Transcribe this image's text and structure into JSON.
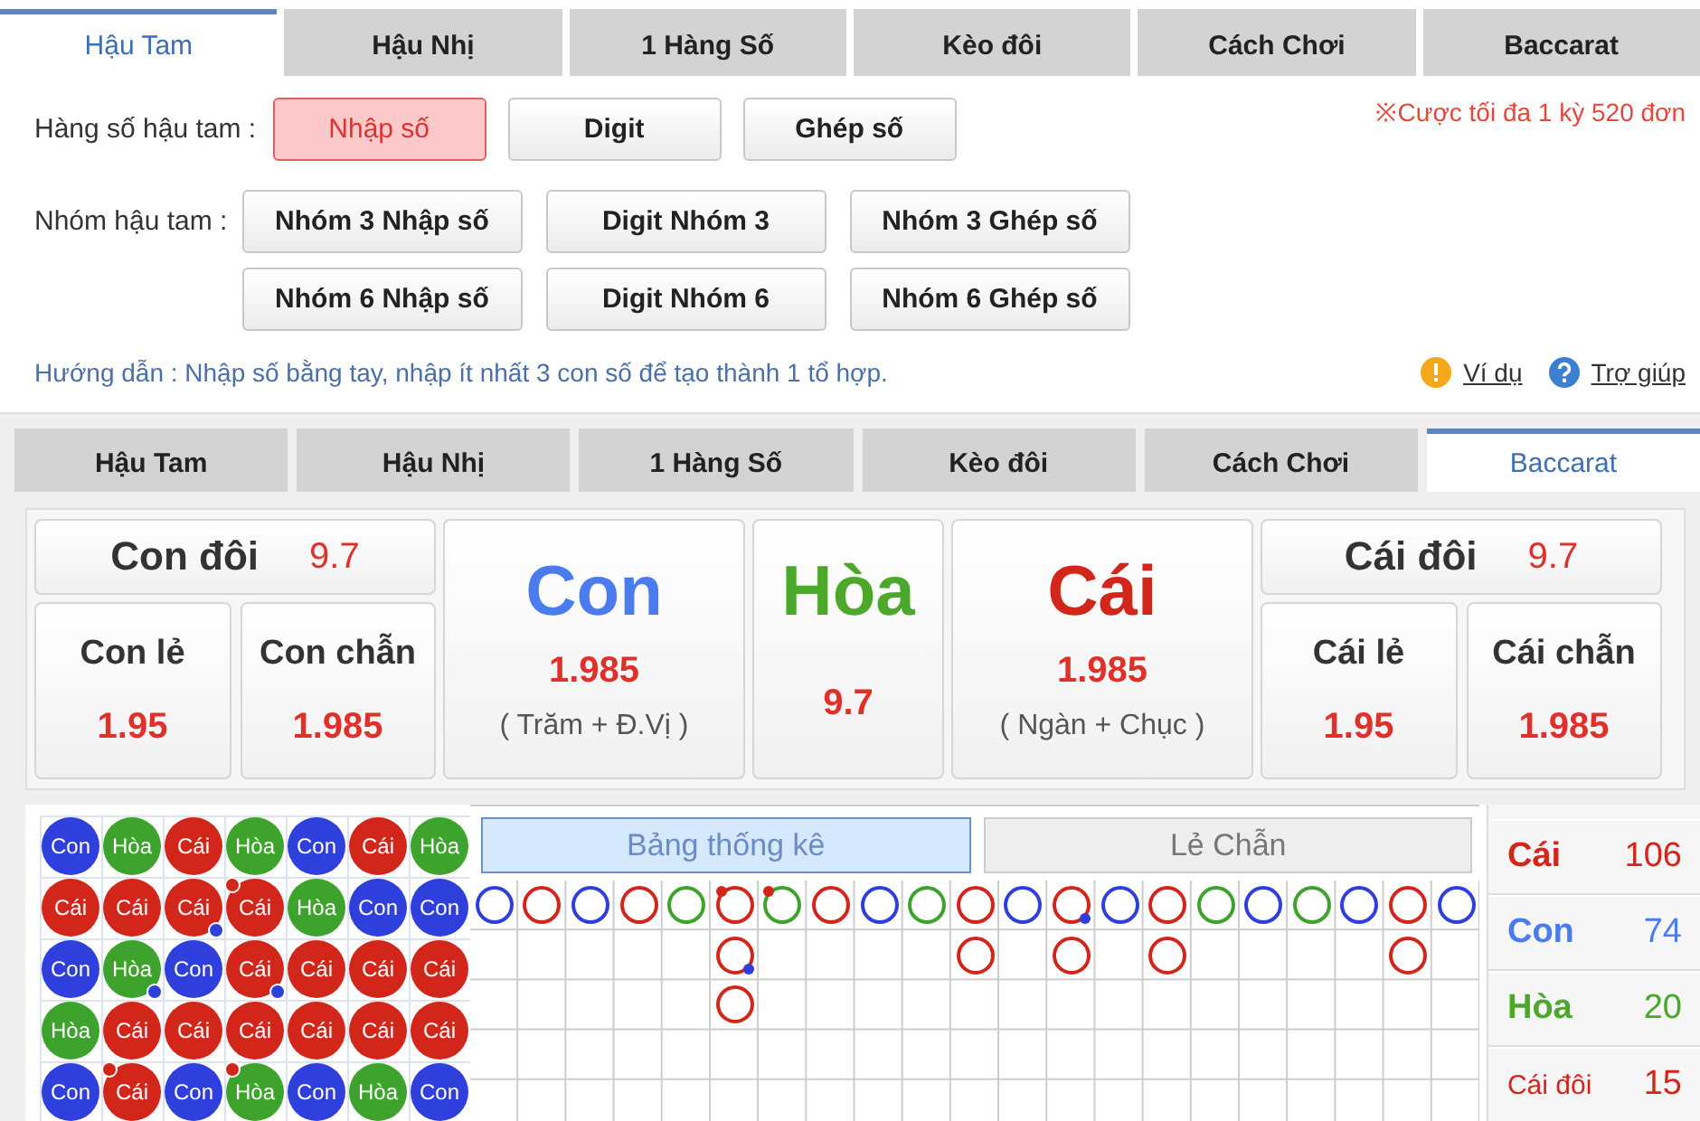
{
  "top_tabs": [
    {
      "label": "Hậu Tam",
      "selected": true
    },
    {
      "label": "Hậu Nhị",
      "selected": false
    },
    {
      "label": "1 Hàng Số",
      "selected": false
    },
    {
      "label": "Kèo đôi",
      "selected": false
    },
    {
      "label": "Cách Chơi",
      "selected": false
    },
    {
      "label": "Baccarat",
      "selected": false
    }
  ],
  "bet_groups": [
    {
      "label": "Hàng số hậu tam :",
      "options": [
        {
          "label": "Nhập số",
          "selected": true
        },
        {
          "label": "Digit",
          "selected": false
        },
        {
          "label": "Ghép số",
          "selected": false
        }
      ]
    },
    {
      "label": "Nhóm hậu tam :",
      "options": [
        {
          "label": "Nhóm 3 Nhập số",
          "selected": false
        },
        {
          "label": "Digit Nhóm 3",
          "selected": false
        },
        {
          "label": "Nhóm 3 Ghép số",
          "selected": false
        },
        {
          "label": "Nhóm 6 Nhập số",
          "selected": false
        },
        {
          "label": "Digit Nhóm 6",
          "selected": false
        },
        {
          "label": "Nhóm 6 Ghép số",
          "selected": false
        }
      ]
    }
  ],
  "limit_note": "※Cược tối đa 1 kỳ 520 đơn",
  "guide": "Hướng dẫn : Nhập số bằng tay, nhập ít nhất 3 con số để tạo thành 1 tổ hợp.",
  "links": [
    {
      "label": "Ví dụ",
      "kind": "info"
    },
    {
      "label": "Trợ giúp",
      "kind": "help"
    }
  ],
  "bottom_tabs": [
    {
      "label": "Hậu Tam",
      "selected": false
    },
    {
      "label": "Hậu Nhị",
      "selected": false
    },
    {
      "label": "1 Hàng Số",
      "selected": false
    },
    {
      "label": "Kèo đôi",
      "selected": false
    },
    {
      "label": "Cách Chơi",
      "selected": false
    },
    {
      "label": "Baccarat",
      "selected": true
    }
  ],
  "odds": {
    "sides": [
      {
        "pair": {
          "label": "Con đôi",
          "value": "9.7"
        },
        "singles": [
          {
            "label": "Con lẻ",
            "value": "1.95"
          },
          {
            "label": "Con chẫn",
            "value": "1.985"
          }
        ]
      },
      {
        "pair": {
          "label": "Cái đôi",
          "value": "9.7"
        },
        "singles": [
          {
            "label": "Cái lẻ",
            "value": "1.95"
          },
          {
            "label": "Cái chẫn",
            "value": "1.985"
          }
        ]
      }
    ],
    "main": [
      {
        "label": "Con",
        "kind": "con",
        "value": "1.985",
        "note": "( Trăm + Đ.Vị )"
      },
      {
        "label": "Hòa",
        "kind": "hoa",
        "value": "9.7"
      },
      {
        "label": "Cái",
        "kind": "cai",
        "value": "1.985",
        "note": "( Ngàn + Chục )"
      }
    ]
  },
  "bead_road": [
    [
      {
        "label": "Con",
        "kind": "con",
        "banker_pair": false,
        "player_pair": false
      },
      {
        "label": "Hòa",
        "kind": "hoa",
        "banker_pair": false,
        "player_pair": false
      },
      {
        "label": "Cái",
        "kind": "cai",
        "banker_pair": false,
        "player_pair": false
      },
      {
        "label": "Hòa",
        "kind": "hoa",
        "banker_pair": false,
        "player_pair": false
      },
      {
        "label": "Con",
        "kind": "con",
        "banker_pair": false,
        "player_pair": false
      },
      {
        "label": "Cái",
        "kind": "cai",
        "banker_pair": false,
        "player_pair": false
      },
      {
        "label": "Hòa",
        "kind": "hoa",
        "banker_pair": false,
        "player_pair": false
      }
    ],
    [
      {
        "label": "Cái",
        "kind": "cai",
        "banker_pair": false,
        "player_pair": false
      },
      {
        "label": "Cái",
        "kind": "cai",
        "banker_pair": false,
        "player_pair": false
      },
      {
        "label": "Cái",
        "kind": "cai",
        "banker_pair": false,
        "player_pair": true
      },
      {
        "label": "Cái",
        "kind": "cai",
        "banker_pair": true,
        "player_pair": false
      },
      {
        "label": "Hòa",
        "kind": "hoa",
        "banker_pair": false,
        "player_pair": false
      },
      {
        "label": "Con",
        "kind": "con",
        "banker_pair": false,
        "player_pair": false
      },
      {
        "label": "Con",
        "kind": "con",
        "banker_pair": false,
        "player_pair": false
      }
    ],
    [
      {
        "label": "Con",
        "kind": "con",
        "banker_pair": false,
        "player_pair": false
      },
      {
        "label": "Hòa",
        "kind": "hoa",
        "banker_pair": false,
        "player_pair": true
      },
      {
        "label": "Con",
        "kind": "con",
        "banker_pair": false,
        "player_pair": false
      },
      {
        "label": "Cái",
        "kind": "cai",
        "banker_pair": false,
        "player_pair": true
      },
      {
        "label": "Cái",
        "kind": "cai",
        "banker_pair": false,
        "player_pair": false
      },
      {
        "label": "Cái",
        "kind": "cai",
        "banker_pair": false,
        "player_pair": false
      },
      {
        "label": "Cái",
        "kind": "cai",
        "banker_pair": false,
        "player_pair": false
      }
    ],
    [
      {
        "label": "Hòa",
        "kind": "hoa",
        "banker_pair": false,
        "player_pair": false
      },
      {
        "label": "Cái",
        "kind": "cai",
        "banker_pair": false,
        "player_pair": false
      },
      {
        "label": "Cái",
        "kind": "cai",
        "banker_pair": false,
        "player_pair": false
      },
      {
        "label": "Cái",
        "kind": "cai",
        "banker_pair": false,
        "player_pair": false
      },
      {
        "label": "Cái",
        "kind": "cai",
        "banker_pair": false,
        "player_pair": false
      },
      {
        "label": "Cái",
        "kind": "cai",
        "banker_pair": false,
        "player_pair": false
      },
      {
        "label": "Cái",
        "kind": "cai",
        "banker_pair": false,
        "player_pair": false
      }
    ],
    [
      {
        "label": "Con",
        "kind": "con",
        "banker_pair": false,
        "player_pair": false
      },
      {
        "label": "Cái",
        "kind": "cai",
        "banker_pair": true,
        "player_pair": false
      },
      {
        "label": "Con",
        "kind": "con",
        "banker_pair": false,
        "player_pair": false
      },
      {
        "label": "Hòa",
        "kind": "hoa",
        "banker_pair": true,
        "player_pair": false
      },
      {
        "label": "Con",
        "kind": "con",
        "banker_pair": false,
        "player_pair": false
      },
      {
        "label": "Hòa",
        "kind": "hoa",
        "banker_pair": false,
        "player_pair": false
      },
      {
        "label": "Con",
        "kind": "con",
        "banker_pair": false,
        "player_pair": false
      }
    ]
  ],
  "stat_tabs": [
    {
      "label": "Bảng thống kê",
      "selected": true
    },
    {
      "label": "Lẻ Chẫn",
      "selected": false
    }
  ],
  "big_road": [
    [
      {
        "kind": "con",
        "banker_pair": false,
        "player_pair": false
      }
    ],
    [
      {
        "kind": "cai",
        "banker_pair": false,
        "player_pair": false
      }
    ],
    [
      {
        "kind": "con",
        "banker_pair": false,
        "player_pair": false
      }
    ],
    [
      {
        "kind": "cai",
        "banker_pair": false,
        "player_pair": false
      }
    ],
    [
      {
        "kind": "hoa",
        "banker_pair": false,
        "player_pair": false
      }
    ],
    [
      {
        "kind": "cai",
        "banker_pair": true,
        "player_pair": false
      },
      {
        "kind": "cai",
        "banker_pair": false,
        "player_pair": true
      },
      {
        "kind": "cai",
        "banker_pair": false,
        "player_pair": false
      }
    ],
    [
      {
        "kind": "hoa",
        "banker_pair": true,
        "player_pair": false
      }
    ],
    [
      {
        "kind": "cai",
        "banker_pair": false,
        "player_pair": false
      }
    ],
    [
      {
        "kind": "con",
        "banker_pair": false,
        "player_pair": false
      }
    ],
    [
      {
        "kind": "hoa",
        "banker_pair": false,
        "player_pair": false
      }
    ],
    [
      {
        "kind": "cai",
        "banker_pair": false,
        "player_pair": false
      },
      {
        "kind": "cai",
        "banker_pair": false,
        "player_pair": false
      }
    ],
    [
      {
        "kind": "con",
        "banker_pair": false,
        "player_pair": false
      }
    ],
    [
      {
        "kind": "cai",
        "banker_pair": false,
        "player_pair": true
      },
      {
        "kind": "cai",
        "banker_pair": false,
        "player_pair": false
      }
    ],
    [
      {
        "kind": "con",
        "banker_pair": false,
        "player_pair": false
      }
    ],
    [
      {
        "kind": "cai",
        "banker_pair": false,
        "player_pair": false
      },
      {
        "kind": "cai",
        "banker_pair": false,
        "player_pair": false
      }
    ],
    [
      {
        "kind": "hoa",
        "banker_pair": false,
        "player_pair": false
      }
    ],
    [
      {
        "kind": "con",
        "banker_pair": false,
        "player_pair": false
      }
    ],
    [
      {
        "kind": "hoa",
        "banker_pair": false,
        "player_pair": false
      }
    ],
    [
      {
        "kind": "con",
        "banker_pair": false,
        "player_pair": false
      }
    ],
    [
      {
        "kind": "cai",
        "banker_pair": false,
        "player_pair": false
      },
      {
        "kind": "cai",
        "banker_pair": false,
        "player_pair": false
      }
    ],
    [
      {
        "kind": "con",
        "banker_pair": false,
        "player_pair": false
      }
    ]
  ],
  "stats": [
    {
      "label": "Cái",
      "value": "106",
      "kind": "cai"
    },
    {
      "label": "Con",
      "value": "74",
      "kind": "con"
    },
    {
      "label": "Hòa",
      "value": "20",
      "kind": "hoa"
    },
    {
      "label": "Cái đôi",
      "value": "15",
      "kind": "cai_pair"
    }
  ]
}
